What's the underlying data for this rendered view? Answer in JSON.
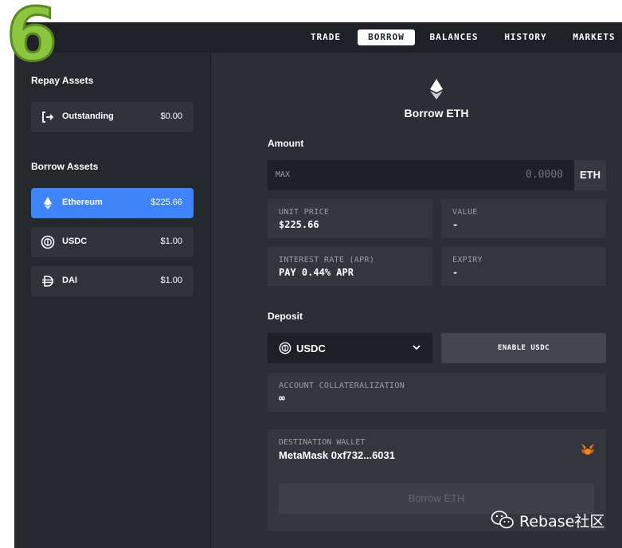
{
  "step_number": "6",
  "nav": {
    "tabs": [
      {
        "label": "TRADE"
      },
      {
        "label": "BORROW",
        "active": true
      },
      {
        "label": "BALANCES"
      },
      {
        "label": "HISTORY"
      },
      {
        "label": "MARKETS"
      }
    ]
  },
  "sidebar": {
    "repay_title": "Repay Assets",
    "repay_items": [
      {
        "name": "Outstanding",
        "amount": "$0.00",
        "icon": "logout-arrow-icon"
      }
    ],
    "borrow_title": "Borrow Assets",
    "borrow_items": [
      {
        "name": "Ethereum",
        "amount": "$225.66",
        "icon": "ethereum-icon",
        "active": true
      },
      {
        "name": "USDC",
        "amount": "$1.00",
        "icon": "usdc-icon"
      },
      {
        "name": "DAI",
        "amount": "$1.00",
        "icon": "dai-icon"
      }
    ]
  },
  "main": {
    "title": "Borrow ETH",
    "amount_label": "Amount",
    "amount_max": "MAX",
    "amount_value": "0.0000",
    "amount_unit": "ETH",
    "unit_price_label": "UNIT PRICE",
    "unit_price_value": "$225.66",
    "value_label": "VALUE",
    "value_value": "-",
    "interest_label": "INTEREST RATE (APR)",
    "interest_value": "PAY 0.44% APR",
    "expiry_label": "EXPIRY",
    "expiry_value": "-",
    "deposit_label": "Deposit",
    "deposit_asset": "USDC",
    "enable_button": "ENABLE USDC",
    "collat_label": "ACCOUNT COLLATERALIZATION",
    "collat_value": "∞",
    "wallet_label": "DESTINATION WALLET",
    "wallet_value": "MetaMask 0xf732...6031",
    "borrow_button": "Borrow ETH"
  },
  "watermark": "Rebase社区",
  "colors": {
    "accent_blue": "#3f83f8",
    "nav_bg": "#1e2126",
    "panel_bg": "#2b2e34",
    "badge_green": "#8cc63f"
  }
}
